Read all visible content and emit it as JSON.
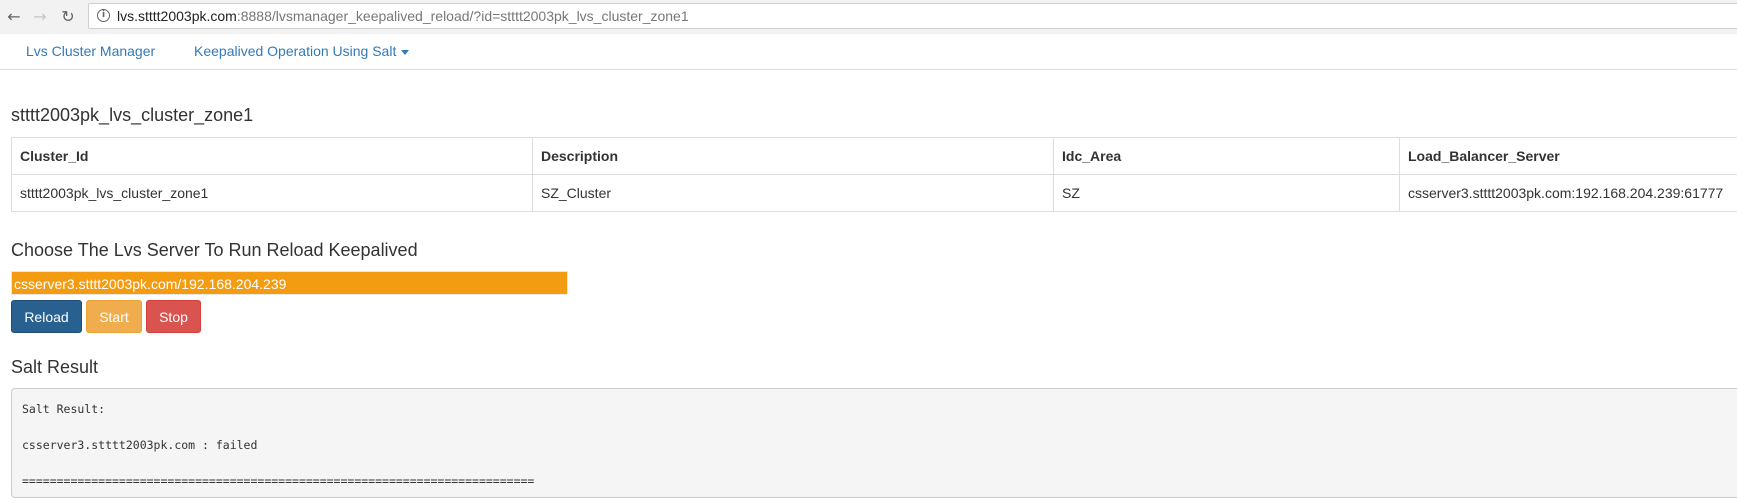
{
  "browser": {
    "url_host": "lvs.stttt2003pk.com",
    "url_rest": ":8888/lvsmanager_keepalived_reload/?id=stttt2003pk_lvs_cluster_zone1"
  },
  "navbar": {
    "brand": "Lvs Cluster Manager",
    "dropdown": "Keepalived Operation Using Salt"
  },
  "cluster": {
    "title": "stttt2003pk_lvs_cluster_zone1",
    "columns": [
      "Cluster_Id",
      "Description",
      "Idc_Area",
      "Load_Balancer_Server"
    ],
    "rows": [
      [
        "stttt2003pk_lvs_cluster_zone1",
        "SZ_Cluster",
        "SZ",
        "csserver3.stttt2003pk.com:192.168.204.239:61777"
      ]
    ]
  },
  "choose": {
    "title": "Choose The Lvs Server To Run Reload Keepalived",
    "selected_server": "csserver3.stttt2003pk.com/192.168.204.239",
    "selected_color": "#f39c12"
  },
  "actions": {
    "reload": "Reload",
    "start": "Start",
    "stop": "Stop"
  },
  "salt": {
    "title": "Salt Result",
    "lines": [
      "Salt Result:",
      "",
      "csserver3.stttt2003pk.com : failed",
      "",
      "=========================================================================="
    ]
  }
}
